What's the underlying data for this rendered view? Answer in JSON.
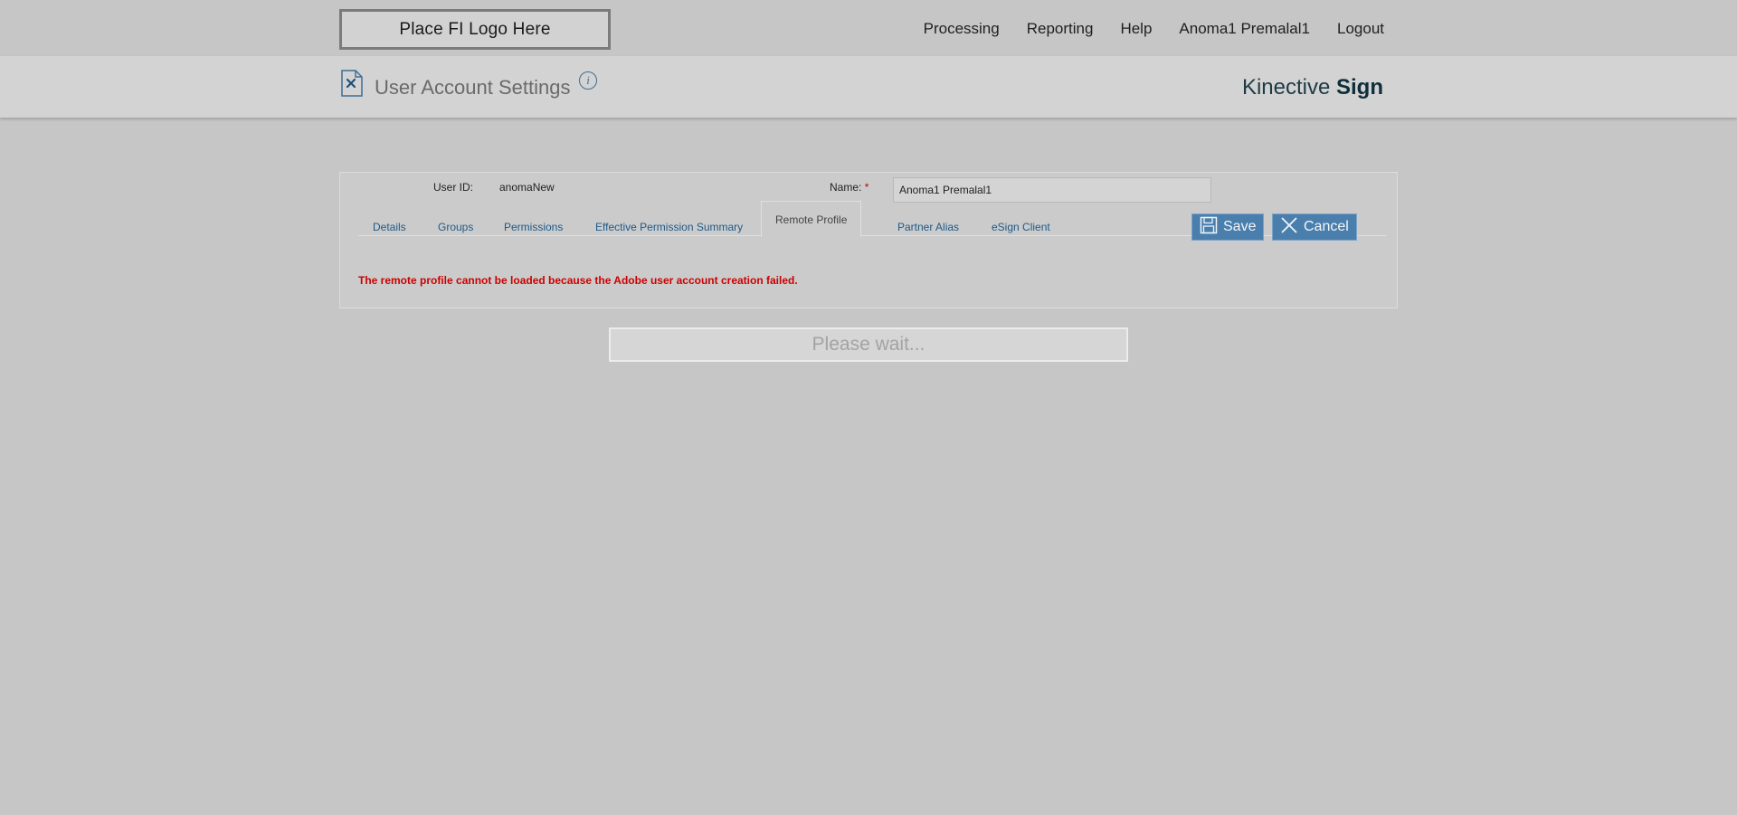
{
  "topbar": {
    "logo_text": "Place FI Logo Here",
    "nav": [
      "Processing",
      "Reporting",
      "Help",
      "Anoma1 Premalal1",
      "Logout"
    ]
  },
  "header": {
    "title": "User Account Settings",
    "info_icon_glyph": "i",
    "brand_light": "Kinective ",
    "brand_bold": "Sign"
  },
  "form": {
    "user_id_label": "User ID:",
    "user_id_value": "anomaNew",
    "name_label": "Name:",
    "name_required_marker": "*",
    "name_value": "Anoma1 Premalal1"
  },
  "tabs": [
    "Details",
    "Groups",
    "Permissions",
    "Effective Permission Summary",
    "Remote Profile",
    "Partner Alias",
    "eSign Client"
  ],
  "active_tab": "Remote Profile",
  "buttons": {
    "save": "Save",
    "cancel": "Cancel"
  },
  "error_message": "The remote profile cannot be loaded because the Adobe user account creation failed.",
  "wait_message": "Please wait...",
  "colors": {
    "background": "#c6c6c6",
    "header_strip": "#d3d3d3",
    "link": "#1e5a8a",
    "button": "#4a7fad",
    "error": "#cc0000",
    "brand": "#1d3a45"
  },
  "icons": {
    "page_icon": "document-x-icon",
    "info_icon": "info-icon",
    "save_icon": "floppy-disk-icon",
    "cancel_icon": "close-icon"
  }
}
